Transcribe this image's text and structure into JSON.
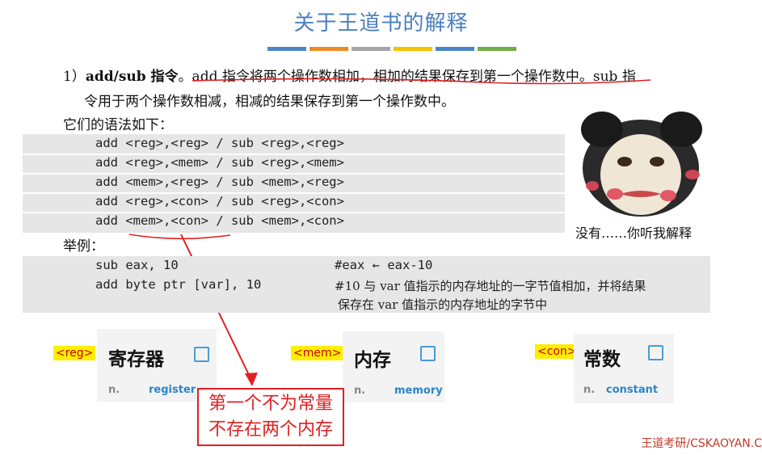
{
  "title": "关于王道书的解释",
  "colorbar_colors": [
    "#4a86c8",
    "#f08a24",
    "#a6a6a6",
    "#f5c200",
    "#4a86c8",
    "#70ad47"
  ],
  "text": {
    "line1_num": "1）",
    "line1_bold": "add/sub 指令",
    "line1_rest": "。add 指令将两个操作数相加，相加的结果保存到第一个操作数中。sub 指",
    "line2": "令用于两个操作数相减，相减的结果保存到第一个操作数中。",
    "line3": "它们的语法如下："
  },
  "syntax_rows": [
    "add <reg>,<reg> / sub <reg>,<reg>",
    "add <reg>,<mem> / sub <reg>,<mem>",
    "add <mem>,<reg> / sub <mem>,<reg>",
    "add <reg>,<con> / sub <reg>,<con>",
    "add <mem>,<con> / sub <mem>,<con>"
  ],
  "example_label": "举例：",
  "examples": {
    "row1_code": "sub eax, 10",
    "row1_comment": "#eax ← eax-10",
    "row2_code": "add byte ptr [var], 10",
    "row2_comment": "#10 与 var 值指示的内存地址的一字节值相加，并将结果",
    "row3_comment": "保存在 var 值指示的内存地址的字节中"
  },
  "meme_caption": "没有……你听我解释",
  "cards": [
    {
      "tag": "<reg>",
      "word": "寄存器",
      "pos": "n.",
      "meaning": "register"
    },
    {
      "tag": "<mem>",
      "word": "内存",
      "pos": "n.",
      "meaning": "memory"
    },
    {
      "tag": "<con>",
      "word": "常数",
      "pos": "n.",
      "meaning": "constant"
    }
  ],
  "note": {
    "line1": "第一个不为常量",
    "line2": "不存在两个内存"
  },
  "footer": "王道考研/CSKAOYAN.C",
  "annotation_color": "#e02020"
}
